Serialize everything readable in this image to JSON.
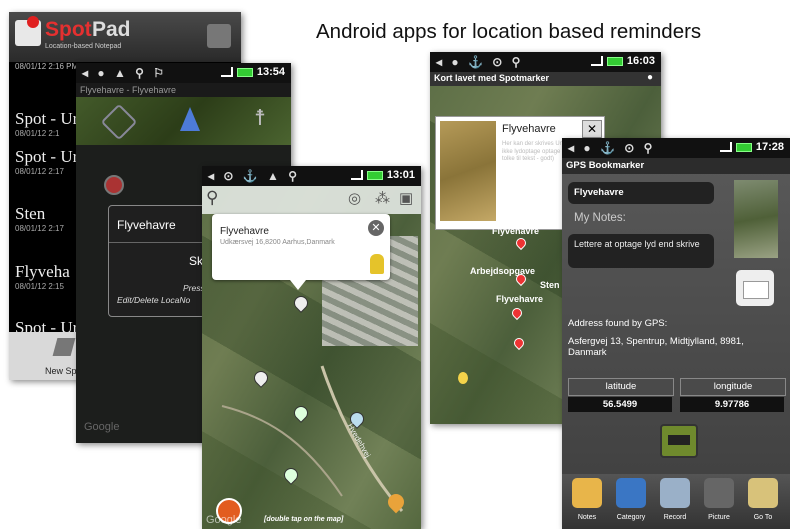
{
  "headline": "Android apps for location based reminders",
  "spotpad": {
    "logo_spot": "Spot",
    "logo_pad": "Pad",
    "subtitle": "Location-based Notepad",
    "items": [
      {
        "title": "Spot - Ur",
        "date": "08/01/12 2:1"
      },
      {
        "title": "Spot - Ur",
        "date": "08/01/12 2:17"
      },
      {
        "title": "Sten",
        "date": "08/01/12 2:17"
      },
      {
        "title": "Flyveha",
        "date": "08/01/12 2:15"
      },
      {
        "title": "Spot - Ur",
        "date": ""
      }
    ],
    "top_date": "08/01/12 2:16 PM",
    "new_button": "New Sp"
  },
  "locanote": {
    "time": "13:54",
    "title": "Flyvehavre - Flyvehavre",
    "dialog_title": "Flyvehavre",
    "dialog_body": "Skal spr",
    "dialog_hint_1": "Press Back t",
    "dialog_hint_2": "Edit/Delete LocaNo",
    "watermark": "Google"
  },
  "gmaps": {
    "time": "13:01",
    "bubble_title": "Flyvehavre",
    "bubble_address": "Udkærsvej 16,8200 Aarhus,Danmark",
    "road_label": "Hvedehvej",
    "footer_hint": "[double tap on the map]",
    "watermark": "Google"
  },
  "spotmarker": {
    "time": "16:03",
    "title": "Kort lavet med Spotmarker",
    "popup_title": "Flyvehavre",
    "popup_text": "Her kan der skrives Understøtter de ikke lydoptage optage lyd, men tolke til tekst - godt)",
    "labels": [
      "Flyvehavre",
      "Arbejdsopgave",
      "Flyvehavre",
      "Sten"
    ]
  },
  "gpsbook": {
    "time": "17:28",
    "title": "GPS Bookmarker",
    "name": "Flyvehavre",
    "notes_label": "My Notes:",
    "notes_text": "Lettere at optage lyd end skrive",
    "address_label": "Address found by GPS:",
    "address": "Asfergvej 13, Spentrup, Midtjylland, 8981, Danmark",
    "lat_label": "latitude",
    "lon_label": "longitude",
    "lat_value": "56.5499",
    "lon_value": "9.97786",
    "tabs": [
      "Notes",
      "Category",
      "Record",
      "Picture",
      "Go To"
    ]
  }
}
